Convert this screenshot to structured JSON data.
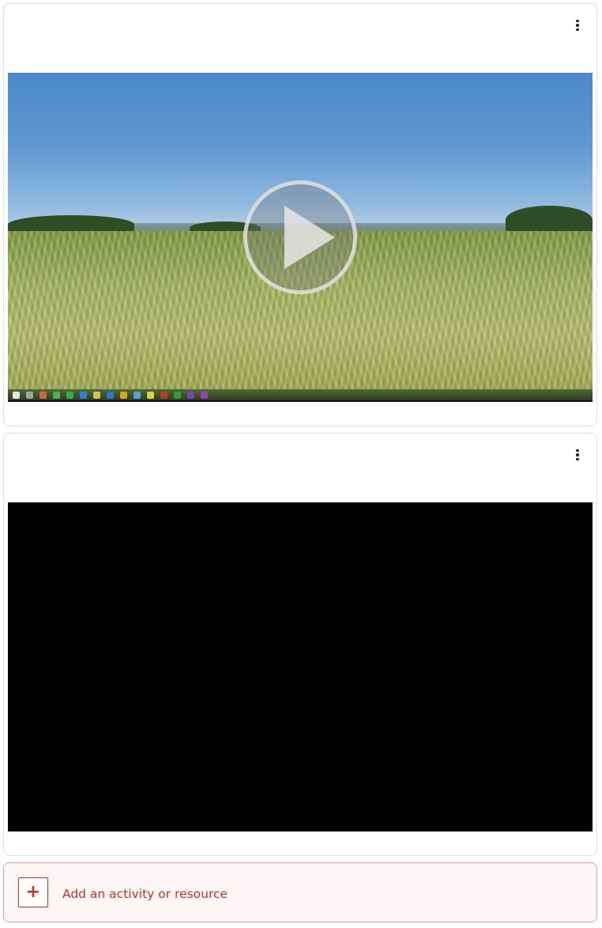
{
  "cards": [
    {
      "menu_icon": "kebab-vertical-icon",
      "video": {
        "state": "poster",
        "poster": "wheat-field-landscape",
        "play_icon": "play-icon"
      }
    },
    {
      "menu_icon": "kebab-vertical-icon",
      "video": {
        "state": "black"
      }
    }
  ],
  "add_activity": {
    "icon": "plus-icon",
    "icon_glyph": "+",
    "label": "Add an activity or resource"
  },
  "colors": {
    "accent": "#ca3120",
    "add_background": "#fff6f7",
    "add_border": "#ee9aa2",
    "card_border": "#dee2e6"
  }
}
